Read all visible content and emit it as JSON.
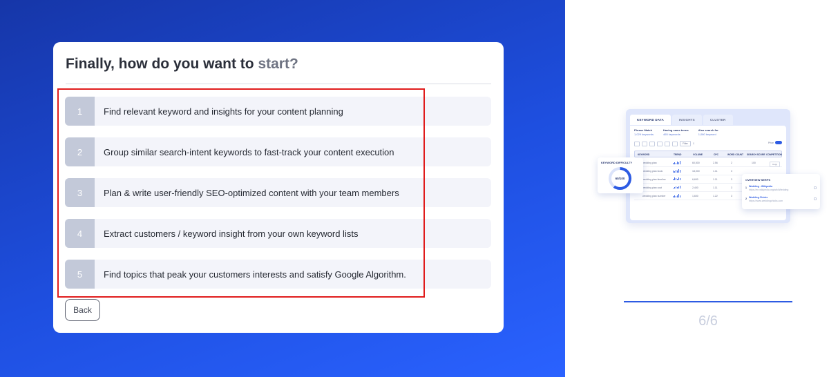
{
  "wizard": {
    "title_main": "Finally, how do you want to",
    "title_accent": "start?",
    "options": [
      {
        "number": "1",
        "label": "Find relevant keyword and insights for your content planning"
      },
      {
        "number": "2",
        "label": "Group similar search-intent keywords to fast-track your content execution"
      },
      {
        "number": "3",
        "label": "Plan & write user-friendly SEO-optimized content with your team members"
      },
      {
        "number": "4",
        "label": "Extract customers / keyword insight from your own keyword lists"
      },
      {
        "number": "5",
        "label": "Find topics that peak your customers interests and satisfy Google Algorithm."
      }
    ],
    "back_label": "Back"
  },
  "preview": {
    "tabs": [
      "KEYWORD DATA",
      "INSIGHTS",
      "CLUSTER"
    ],
    "stats": [
      {
        "title": "Phrase Match",
        "sub": "1,029 keywords"
      },
      {
        "title": "Having same terms",
        "sub": "465 keywords"
      },
      {
        "title": "Also search for",
        "sub": "1,080 keyword"
      }
    ],
    "filter_label": "Filter",
    "price_label": "Price",
    "table_headers": [
      "KEYWORD",
      "TREND",
      "VOLUME",
      "CPC",
      "WORD COUNT",
      "SEARCH SCORE",
      "COMPETITION"
    ],
    "rows": [
      {
        "keyword": "wedding plan",
        "volume": "60,500",
        "cpc": "2.56",
        "wc": "2",
        "score": "100",
        "comp": "Copy"
      },
      {
        "keyword": "wedding plan book",
        "volume": "18,000",
        "cpc": "1.11",
        "wc": "3",
        "score": "",
        "comp": ""
      },
      {
        "keyword": "wedding plan timeline",
        "volume": "6,600",
        "cpc": "1.11",
        "wc": "3",
        "score": "",
        "comp": ""
      },
      {
        "keyword": "wedding plan cost",
        "volume": "2,400",
        "cpc": "1.11",
        "wc": "3",
        "score": "",
        "comp": ""
      },
      {
        "keyword": "wedding plan number",
        "volume": "1,600",
        "cpc": "1.22",
        "wc": "3",
        "score": "",
        "comp": ""
      }
    ],
    "kd_title": "KEYWORD DIFFICULTY",
    "kd_value": "60/100",
    "kd_fraction": 0.6,
    "serp_title": "OVERVIEW SERPS",
    "serp_items": [
      {
        "n": "1",
        "title": "Wedding - Wikipedia",
        "url": "https://en.wikipedia.org/wiki/Wedding"
      },
      {
        "n": "2",
        "title": "Wedding Chicks",
        "url": "https://www.weddingchicks.com"
      }
    ]
  },
  "progress": {
    "step_text": "6/6"
  },
  "colors": {
    "accent": "#2d5be3",
    "highlight": "#e01b1b",
    "number_badge": "#c3c9d9",
    "option_bg": "#f3f4fa"
  }
}
